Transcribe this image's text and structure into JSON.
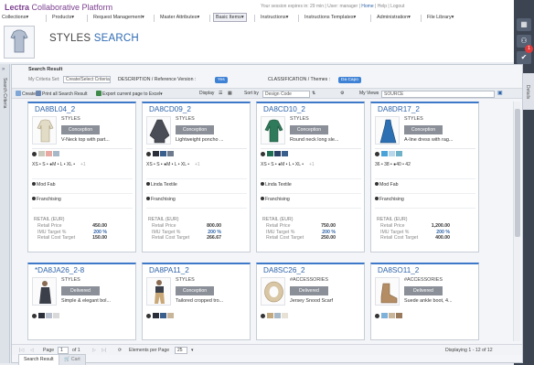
{
  "header": {
    "brand_prefix": "Lectra",
    "brand_rest": "Collaborative Platform",
    "session_prefix": "Your session expires in: 29 min | User:",
    "user": "manager",
    "home": "Home",
    "help": "Help",
    "logout": "Logout",
    "sep1": "|",
    "sep2": "|",
    "title_main": "STYLES",
    "title_accent": "SEARCH"
  },
  "menu": [
    "Collections",
    "Products",
    "Request Management",
    "Master Attributes",
    "Basic Items",
    "Instructions",
    "Instructions Templates",
    "Administration",
    "File Library"
  ],
  "sidebar": {
    "label": "Search Criteria"
  },
  "details_tab": "Details",
  "notification_count": "1",
  "panel": {
    "title": "Search Result",
    "criteria_label": "My Criteria Set:",
    "criteria_value": "Create/Select Criteria Set",
    "desc_label": "DESCRIPTION / Reference Version :",
    "desc_value": "Yes",
    "class_label": "CLASSIFICATION / Themes :",
    "class_value": "Da Capo",
    "toolbar": {
      "create": "Create",
      "print": "Print all Search Result",
      "export": "Export current page to Excel",
      "display": "Display",
      "sort_label": "Sort by",
      "sort_value": "Design Code",
      "views_label": "My Views",
      "views_value": "SOURCE"
    }
  },
  "cards": [
    {
      "code": "DA8BL04_2",
      "category": "STYLES",
      "status": "Conception",
      "desc": "V-Neck top with part...",
      "sizes": "XS • S • ●M • L • XL •",
      "more": "+1",
      "supplier": "Mod Fab",
      "channel": "Franchising",
      "retail_label": "RETAIL (EUR)",
      "retail_price_label": "Retail Price",
      "retail_price": "450.00",
      "imu_label": "IMU Target %",
      "imu": "200 %",
      "cost_label": "Retail Cost Target",
      "cost": "150.00",
      "colors": [
        "#c9c9bd",
        "#e7a9a2",
        "#a7b9c8"
      ]
    },
    {
      "code": "DA8CD09_2",
      "category": "STYLES",
      "status": "Conception",
      "desc": "Lightweight poncho ...",
      "sizes": "XS • S • ●M • L • XL •",
      "more": "+1",
      "supplier": "Linda Textile",
      "channel": "Franchising",
      "retail_label": "RETAIL (EUR)",
      "retail_price_label": "Retail Price",
      "retail_price": "800.00",
      "imu_label": "IMU Target %",
      "imu": "200 %",
      "cost_label": "Retail Cost Target",
      "cost": "266.67",
      "colors": [
        "#2b2f3a",
        "#3b5f8c",
        "#6e7b8f"
      ]
    },
    {
      "code": "DA8CD10_2",
      "category": "STYLES",
      "status": "Conception",
      "desc": "Round neck long sle...",
      "sizes": "XS • S • ●M • L • XL •",
      "more": "+1",
      "supplier": "Linda Textile",
      "channel": "Franchising",
      "retail_label": "RETAIL (EUR)",
      "retail_price_label": "Retail Price",
      "retail_price": "750.00",
      "imu_label": "IMU Target %",
      "imu": "200 %",
      "cost_label": "Retail Cost Target",
      "cost": "250.00",
      "colors": [
        "#1f6d52",
        "#2b3e64",
        "#3b5f8c"
      ]
    },
    {
      "code": "DA8DR17_2",
      "category": "STYLES",
      "status": "Conception",
      "desc": "A-line dress with rag...",
      "sizes": "36 • 38 • ●40 • 42",
      "more": "",
      "supplier": "Mod Fab",
      "channel": "Franchising",
      "retail_label": "RETAIL (EUR)",
      "retail_price_label": "Retail Price",
      "retail_price": "1,200.00",
      "imu_label": "IMU Target %",
      "imu": "200 %",
      "cost_label": "Retail Cost Target",
      "cost": "400.00",
      "colors": [
        "#4aa3d8",
        "#b8d7ea",
        "#6fb2c8"
      ]
    },
    {
      "code": "*DA8JA26_2-8",
      "category": "STYLES",
      "status": "Delivered",
      "desc": "Simple & elegant bol...",
      "colors": [
        "#2b2f3a",
        "#b7c0cc",
        "#d9d9d9"
      ]
    },
    {
      "code": "DA8PA11_2",
      "category": "STYLES",
      "status": "Conception",
      "desc": "Tailored cropped tro...",
      "colors": [
        "#2b2f3a",
        "#3b5f8c",
        "#c9b59a"
      ]
    },
    {
      "code": "DA8SC26_2",
      "category": "#ACCESSORIES",
      "status": "Delivered",
      "desc": "Jersey Snood Scarf",
      "colors": [
        "#c2a97f",
        "#a7b9c8",
        "#e7e1d6"
      ]
    },
    {
      "code": "DA8SO11_2",
      "category": "#ACCESSORIES",
      "status": "Delivered",
      "desc": "Suede ankle boot, 4...",
      "colors": [
        "#7fb2d9",
        "#c9b59a",
        "#9a7a5c"
      ]
    }
  ],
  "pager": {
    "page_label": "Page",
    "page_value": "1",
    "of": "of 1",
    "per_page_label": "Elements per Page",
    "per_page_value": "25",
    "displaying": "Displaying 1 - 12 of 12"
  },
  "bottom_tabs": [
    "Search Result",
    "Cart"
  ],
  "icons": {
    "rail": [
      "grid-icon",
      "user-add-icon",
      "checklist-icon"
    ]
  }
}
